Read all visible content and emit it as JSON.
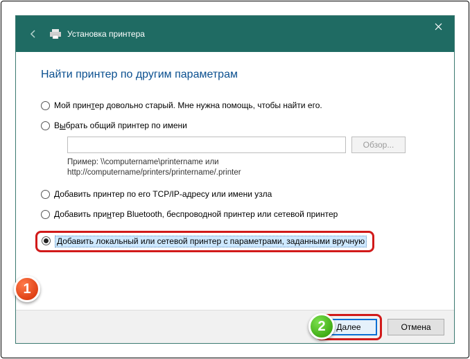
{
  "titlebar": {
    "title": "Установка принтера"
  },
  "heading": "Найти принтер по другим параметрам",
  "options": {
    "old_pre": "Мой прин",
    "old_u": "т",
    "old_post": "ер довольно старый. Мне нужна помощь, чтобы найти его.",
    "shared_pre": "В",
    "shared_u": "ы",
    "shared_post": "брать общий принтер по имени",
    "browse": "Обзор...",
    "example_l1": "Пример: \\\\computername\\printername или",
    "example_l2": "http://computername/printers/printername/.printer",
    "tcpip": "Добавить принтер по его TCP/IP-адресу или имени узла",
    "bt_pre": "Добавить при",
    "bt_u": "н",
    "bt_post": "тер Bluetooth, беспроводной принтер или сетевой принтер",
    "manual": "Добавить локальный или сетевой принтер с параметрами, заданными вручную"
  },
  "footer": {
    "next_pre": "",
    "next_u": "Д",
    "next_post": "алее",
    "cancel": "Отмена"
  },
  "badges": {
    "one": "1",
    "two": "2"
  }
}
